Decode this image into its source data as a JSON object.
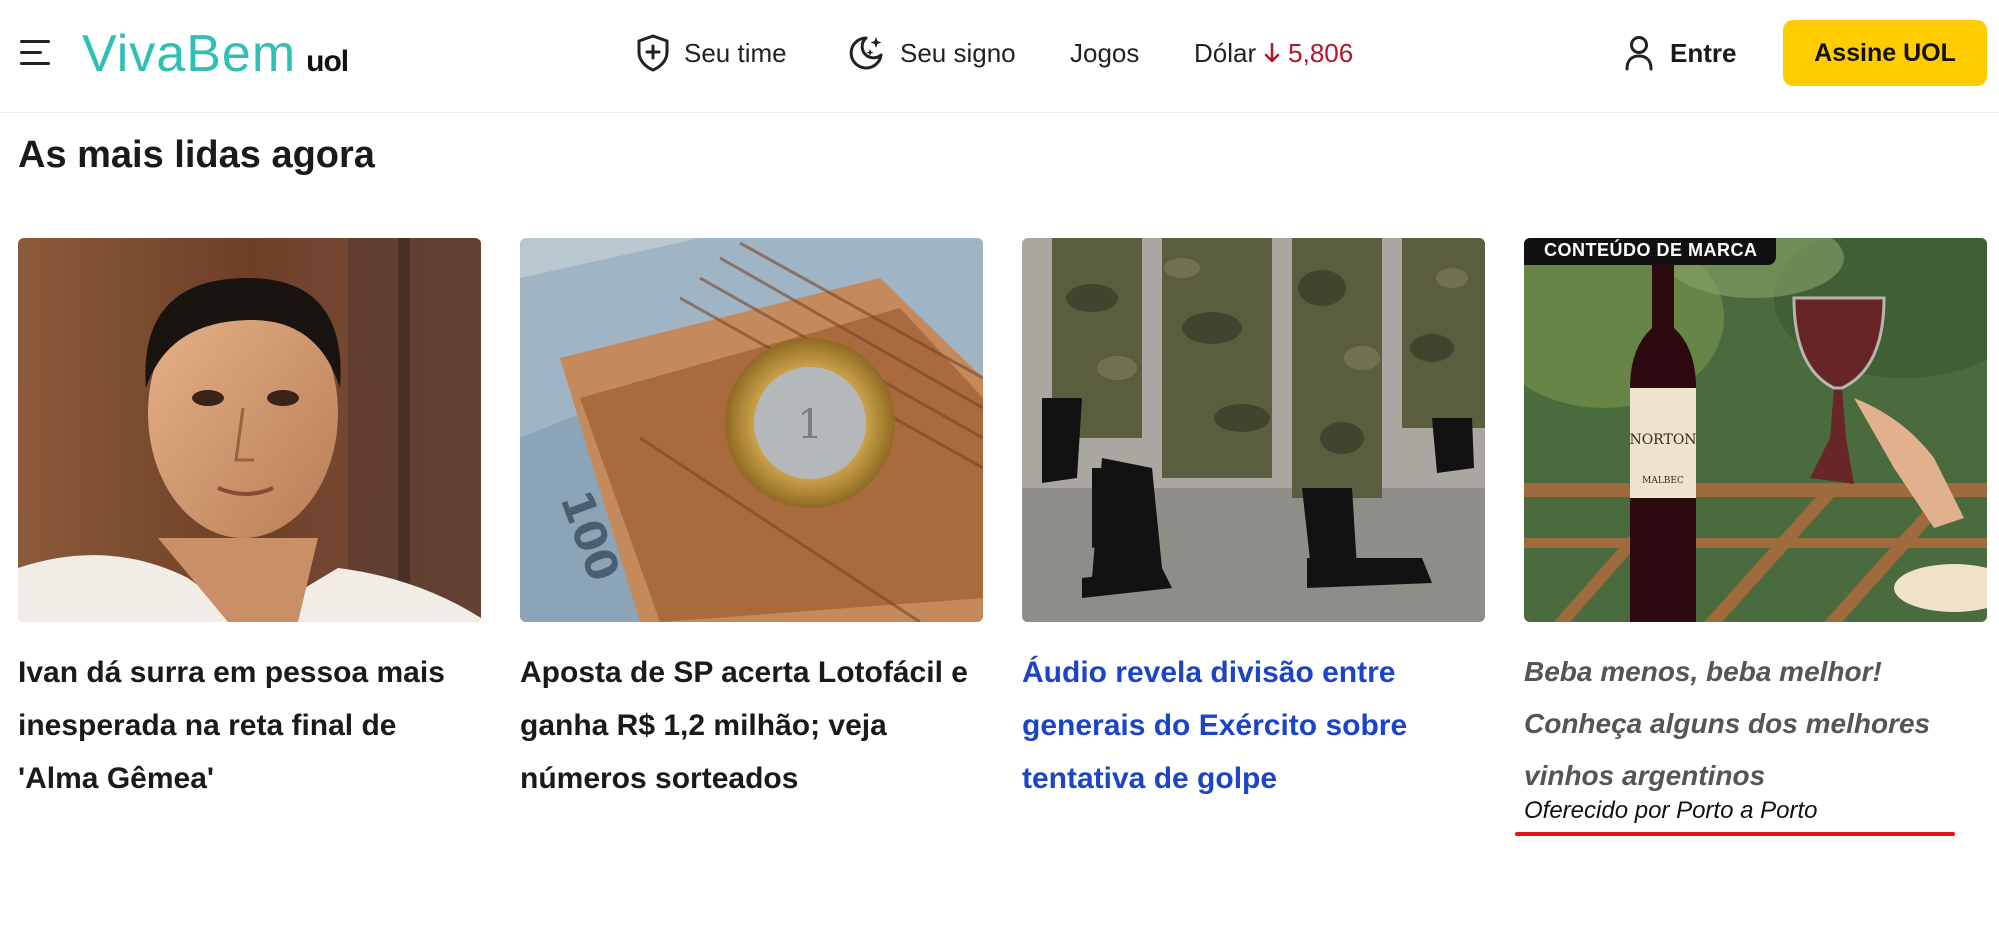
{
  "header": {
    "logo_main": "VivaBem",
    "logo_sub": "uol",
    "nav": [
      {
        "label": "Seu time",
        "icon": "shield-plus-icon"
      },
      {
        "label": "Seu signo",
        "icon": "moon-stars-icon"
      },
      {
        "label": "Jogos"
      },
      {
        "label": "Dólar"
      }
    ],
    "dolar_value": "5,806",
    "dolar_trend": "down",
    "login_label": "Entre",
    "subscribe_label": "Assine UOL",
    "colors": {
      "brand": "#2fc0b4",
      "subscribe": "#ffcc00",
      "down": "#b5142c"
    }
  },
  "section": {
    "title": "As mais lidas agora"
  },
  "cards": [
    {
      "headline": "Ivan dá surra em pessoa mais inesperada na reta final de 'Alma Gêmea'",
      "image": "man-portrait"
    },
    {
      "headline": "Aposta de SP acerta Lotofácil e ganha R$ 1,2 milhão; veja números sorteados",
      "image": "money-coin"
    },
    {
      "headline": "Áudio revela divisão entre generais do Exército sobre tentativa de golpe",
      "image": "soldiers-boots",
      "color": "#1c44c9"
    },
    {
      "badge": "CONTEÚDO DE MARCA",
      "headline": "Beba menos, beba melhor! Conheça alguns dos melhores vinhos argentinos",
      "sponsor": "Oferecido por Porto a Porto",
      "image": "wine-bottle-glass"
    }
  ]
}
